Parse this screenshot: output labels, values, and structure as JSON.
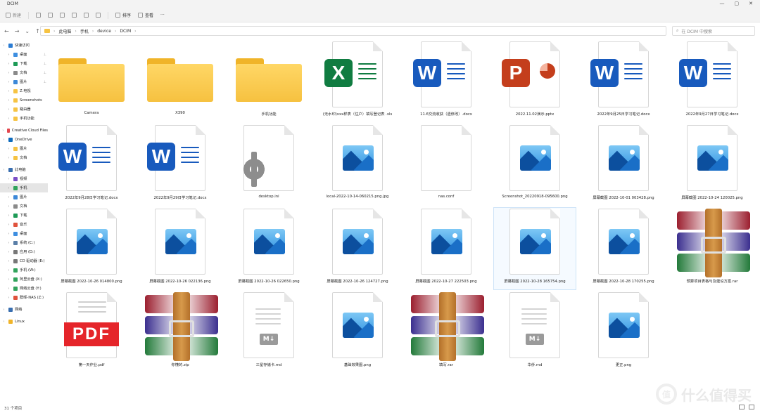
{
  "window": {
    "title": "DCIM",
    "controls": [
      "—",
      "▢",
      "✕"
    ]
  },
  "toolbar": {
    "new_label": "新建",
    "sort_label": "排序",
    "view_label": "查看",
    "more_label": "···"
  },
  "address": {
    "crumbs": [
      "此电脑",
      "手机",
      "device",
      "DCIM"
    ],
    "search_placeholder": "在 DCIM 中搜索"
  },
  "sidebar": {
    "items": [
      {
        "label": "快速访问",
        "color": "#2b7cd3",
        "pin": false
      },
      {
        "label": "桌面",
        "color": "#3d8ee0",
        "pin": true
      },
      {
        "label": "下载",
        "color": "#1d9a56",
        "pin": true
      },
      {
        "label": "文档",
        "color": "#8a8a8a",
        "pin": true
      },
      {
        "label": "图片",
        "color": "#3c88d8",
        "pin": true
      },
      {
        "label": "Z.电视",
        "color": "#f6c343",
        "pin": false
      },
      {
        "label": "Screenshots",
        "color": "#f6c343",
        "pin": false
      },
      {
        "label": "路由器",
        "color": "#f6c343",
        "pin": false
      },
      {
        "label": "手机功能",
        "color": "#f6c343",
        "pin": false
      },
      {
        "label": "Creative Cloud Files",
        "color": "#e34850",
        "pin": false
      },
      {
        "label": "OneDrive",
        "color": "#0f6cbd",
        "pin": false
      },
      {
        "label": "图片",
        "color": "#f6c343",
        "pin": false
      },
      {
        "label": "文档",
        "color": "#f6c343",
        "pin": false
      },
      {
        "label": "此电脑",
        "color": "#3a6fb0",
        "pin": false
      },
      {
        "label": "视频",
        "color": "#7b4fc7",
        "pin": false
      },
      {
        "label": "手机",
        "color": "#31a35c",
        "pin": false
      },
      {
        "label": "图片",
        "color": "#3c88d8",
        "pin": false
      },
      {
        "label": "文档",
        "color": "#8a8a8a",
        "pin": false
      },
      {
        "label": "下载",
        "color": "#1d9a56",
        "pin": false
      },
      {
        "label": "音乐",
        "color": "#e0533d",
        "pin": false
      },
      {
        "label": "桌面",
        "color": "#3d8ee0",
        "pin": false
      },
      {
        "label": "系统 (C:)",
        "color": "#5a7fa8",
        "pin": false
      },
      {
        "label": "应用 (D:)",
        "color": "#777777",
        "pin": false
      },
      {
        "label": "CD 驱动器 (E:)",
        "color": "#777777",
        "pin": false
      },
      {
        "label": "手机 (W:)",
        "color": "#31a35c",
        "pin": false
      },
      {
        "label": "阿里云盘 (X:)",
        "color": "#31a35c",
        "pin": false
      },
      {
        "label": "网络云盘 (Y:)",
        "color": "#31a35c",
        "pin": false
      },
      {
        "label": "群晖-NAS (Z:)",
        "color": "#e0533d",
        "pin": false
      },
      {
        "label": "网络",
        "color": "#3a6fb0",
        "pin": false
      },
      {
        "label": "Linux",
        "color": "#f0b429",
        "pin": false
      }
    ]
  },
  "files": [
    {
      "name": "Camera",
      "type": "folder"
    },
    {
      "name": "X390",
      "type": "folder"
    },
    {
      "name": "手机功能",
      "type": "folder"
    },
    {
      "name": "(无水印)xxx样表（住户）填写登记表 .xls",
      "type": "excel"
    },
    {
      "name": "11.6交流收获（遗修改）.docx",
      "type": "word"
    },
    {
      "name": "2022.11.02演示.pptx",
      "type": "ppt"
    },
    {
      "name": "2022年9月25日学习笔记.docx",
      "type": "word"
    },
    {
      "name": "2022年9月27日学习笔记.docx",
      "type": "word"
    },
    {
      "name": "2022年9月28日学习笔记.docx",
      "type": "word"
    },
    {
      "name": "2022年9月29日学习笔记.docx",
      "type": "word"
    },
    {
      "name": "desktop.ini",
      "type": "ini"
    },
    {
      "name": "local-2022-10-14-060215.png.jpg",
      "type": "image"
    },
    {
      "name": "nas.conf",
      "type": "blank"
    },
    {
      "name": "Screenshot_20220918-095600.png",
      "type": "image"
    },
    {
      "name": "屏幕截图 2022-10-01 003428.png",
      "type": "image"
    },
    {
      "name": "屏幕截图 2022-10-24 120025.png",
      "type": "image"
    },
    {
      "name": "屏幕截图 2022-10-26 014800.png",
      "type": "image"
    },
    {
      "name": "屏幕截图 2022-10-26 022136.png",
      "type": "image"
    },
    {
      "name": "屏幕截图 2022-10-26 022650.png",
      "type": "image"
    },
    {
      "name": "屏幕截图 2022-10-26 124727.png",
      "type": "image"
    },
    {
      "name": "屏幕截图 2022-10-27 222503.png",
      "type": "image"
    },
    {
      "name": "屏幕截图 2022-10-28 165754.png",
      "type": "image",
      "selected": true
    },
    {
      "name": "屏幕截图 2022-10-28 170255.png",
      "type": "image"
    },
    {
      "name": "预算项目表格与及建设方案.rar",
      "type": "rar"
    },
    {
      "name": "第一天作业.pdf",
      "type": "pdf"
    },
    {
      "name": "你懂的.zip",
      "type": "rar"
    },
    {
      "name": "三星存储卡.md",
      "type": "md"
    },
    {
      "name": "基础效果图.png",
      "type": "image"
    },
    {
      "name": "填写.rar",
      "type": "rar"
    },
    {
      "name": "华侨.md",
      "type": "md"
    },
    {
      "name": "更正.png",
      "type": "image"
    }
  ],
  "status": {
    "count": "31 个项目"
  },
  "watermark": {
    "text": "什么值得买",
    "logo": "值"
  },
  "colors": {
    "word": "#185abd",
    "excel": "#107c41",
    "ppt": "#c43e1c",
    "pdf": "#e5252a"
  }
}
